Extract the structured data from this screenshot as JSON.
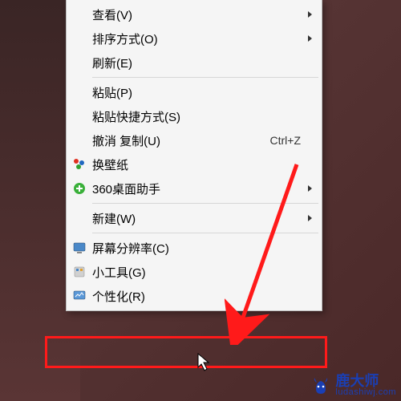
{
  "menu": {
    "view": "查看(V)",
    "sort": "排序方式(O)",
    "refresh": "刷新(E)",
    "paste": "粘贴(P)",
    "paste_shortcut": "粘贴快捷方式(S)",
    "undo_copy": "撤消 复制(U)",
    "undo_shortcut": "Ctrl+Z",
    "wallpaper": "换壁纸",
    "desktop_helper": "360桌面助手",
    "new": "新建(W)",
    "resolution": "屏幕分辨率(C)",
    "gadgets": "小工具(G)",
    "personalize": "个性化(R)"
  },
  "watermark": {
    "name": "鹿大师",
    "url": "ludashiwj.com"
  }
}
